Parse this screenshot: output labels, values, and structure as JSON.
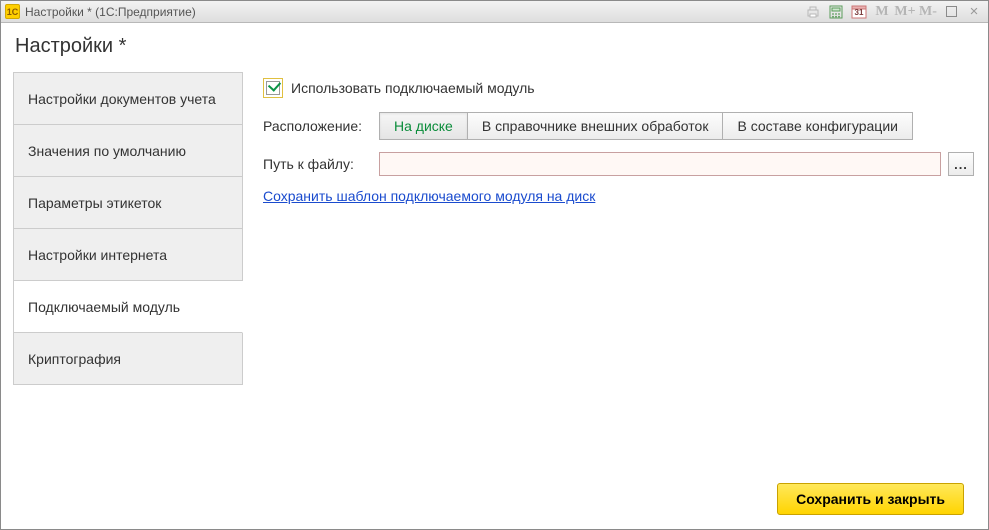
{
  "titlebar": {
    "app_icon_text": "1C",
    "title": "Настройки * (1С:Предприятие)",
    "tools": {
      "print": "print-icon",
      "calc": "calculator-icon",
      "calendar": "calendar-icon",
      "calendar_day": "31",
      "m": "M",
      "mplus": "M+",
      "mminus": "M-",
      "max": "maximize-icon",
      "close": "×"
    }
  },
  "page": {
    "title": "Настройки *"
  },
  "tabs": {
    "items": [
      {
        "label": "Настройки документов учета",
        "name": "tab-doc-settings",
        "active": false
      },
      {
        "label": "Значения по умолчанию",
        "name": "tab-defaults",
        "active": false
      },
      {
        "label": "Параметры этикеток",
        "name": "tab-labels",
        "active": false
      },
      {
        "label": "Настройки интернета",
        "name": "tab-internet",
        "active": false
      },
      {
        "label": "Подключаемый модуль",
        "name": "tab-plugin",
        "active": true
      },
      {
        "label": "Криптография",
        "name": "tab-crypto",
        "active": false
      }
    ]
  },
  "plugin": {
    "use_label": "Использовать подключаемый модуль",
    "use_checked": true,
    "location_label": "Расположение:",
    "location_options": [
      {
        "label": "На диске",
        "name": "loc-on-disk",
        "active": true
      },
      {
        "label": "В справочнике внешних обработок",
        "name": "loc-ext-catalog",
        "active": false
      },
      {
        "label": "В составе конфигурации",
        "name": "loc-in-config",
        "active": false
      }
    ],
    "path_label": "Путь к файлу:",
    "path_value": "",
    "browse_label": "...",
    "save_template_link": "Сохранить шаблон подключаемого модуля на диск"
  },
  "footer": {
    "save_close": "Сохранить и закрыть"
  }
}
